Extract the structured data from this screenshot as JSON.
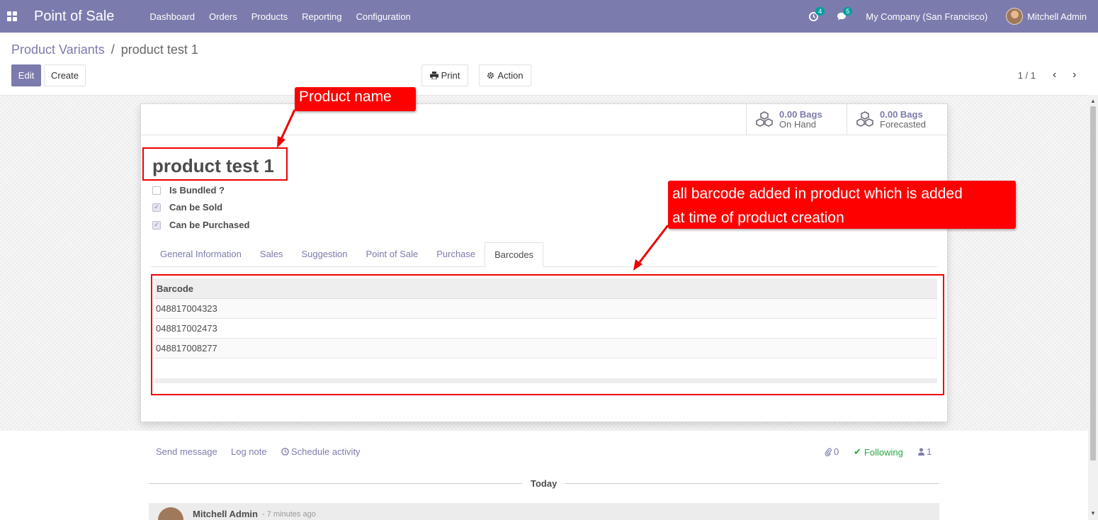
{
  "navbar": {
    "app_title": "Point of Sale",
    "menu": [
      "Dashboard",
      "Orders",
      "Products",
      "Reporting",
      "Configuration"
    ],
    "activity_count": "4",
    "message_count": "5",
    "company": "My Company (San Francisco)",
    "user": "Mitchell Admin",
    "color": "#7c7bad"
  },
  "breadcrumb": {
    "parent": "Product Variants",
    "separator": "/",
    "current": "product test 1"
  },
  "toolbar": {
    "edit": "Edit",
    "create": "Create",
    "print": "Print",
    "action": "Action"
  },
  "pager": {
    "value": "1 / 1"
  },
  "stats": [
    {
      "value": "0.00 Bags",
      "label": "On Hand",
      "icon": "cubes-icon"
    },
    {
      "value": "0.00 Bags",
      "label": "Forecasted",
      "icon": "cubes-icon"
    }
  ],
  "product": {
    "name": "product test 1",
    "checks": [
      {
        "label": "Is Bundled ?",
        "checked": false
      },
      {
        "label": "Can be Sold",
        "checked": true
      },
      {
        "label": "Can be Purchased",
        "checked": true
      }
    ]
  },
  "tabs": [
    "General Information",
    "Sales",
    "Suggestion",
    "Point of Sale",
    "Purchase",
    "Barcodes"
  ],
  "active_tab": "Barcodes",
  "barcodes": {
    "header": "Barcode",
    "rows": [
      "048817004323",
      "048817002473",
      "048817008277"
    ]
  },
  "annotations": {
    "name_callout": "Product name",
    "barcode_callout_line1": "all barcode added in product which is added",
    "barcode_callout_line2": "at time of product creation"
  },
  "chatter": {
    "send_message": "Send message",
    "log_note": "Log note",
    "schedule_activity": "Schedule activity",
    "attachments": "0",
    "following": "Following",
    "followers": "1",
    "today": "Today",
    "message_author": "Mitchell Admin",
    "message_time": "- 7 minutes ago"
  }
}
